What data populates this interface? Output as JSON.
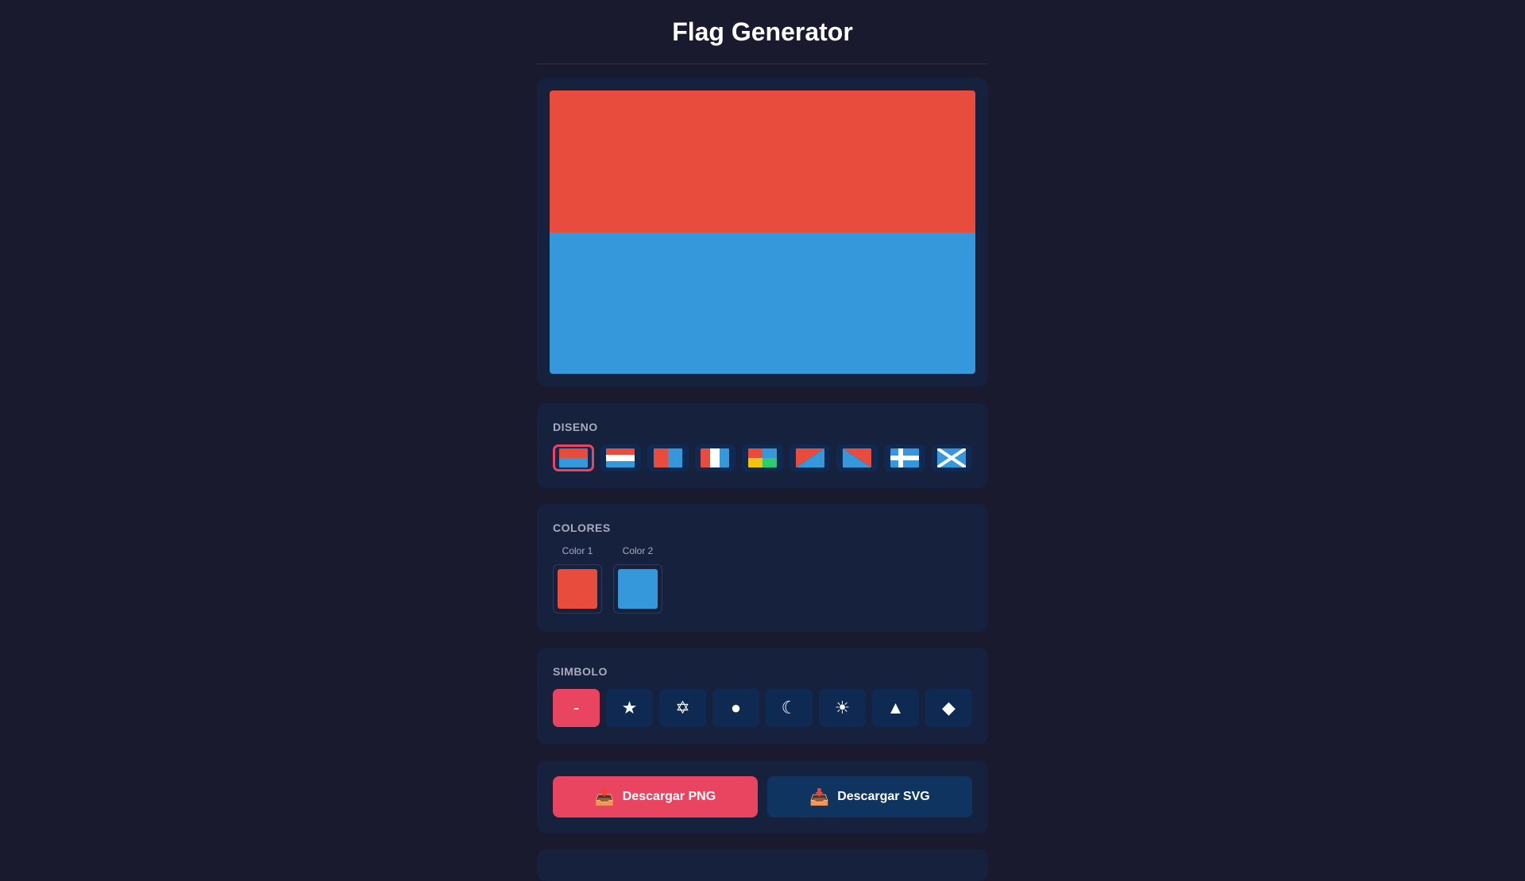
{
  "title": "Flag Generator",
  "preview": {
    "stripe_colors": [
      "#e74c3c",
      "#3498db"
    ]
  },
  "design": {
    "label": "DISENO",
    "selected_index": 0,
    "options": [
      {
        "icon": "horizontal-bicolor-icon"
      },
      {
        "icon": "horizontal-tricolor-icon"
      },
      {
        "icon": "vertical-bicolor-icon"
      },
      {
        "icon": "vertical-tricolor-icon"
      },
      {
        "icon": "quartered-icon"
      },
      {
        "icon": "diagonal-icon"
      },
      {
        "icon": "diagonal-reverse-icon"
      },
      {
        "icon": "nordic-cross-icon"
      },
      {
        "icon": "saltire-icon"
      }
    ]
  },
  "colors": {
    "label": "COLORES",
    "items": [
      {
        "label": "Color 1",
        "value": "#e74c3c"
      },
      {
        "label": "Color 2",
        "value": "#3498db"
      }
    ]
  },
  "symbol": {
    "label": "SIMBOLO",
    "selected_index": 0,
    "options": [
      {
        "glyph": "-",
        "icon": "none-icon"
      },
      {
        "glyph": "★",
        "icon": "star-icon"
      },
      {
        "glyph": "✡",
        "icon": "star-of-david-icon"
      },
      {
        "glyph": "●",
        "icon": "circle-icon"
      },
      {
        "glyph": "☾",
        "icon": "crescent-moon-icon"
      },
      {
        "glyph": "☀",
        "icon": "sun-icon"
      },
      {
        "glyph": "▲",
        "icon": "triangle-icon"
      },
      {
        "glyph": "◆",
        "icon": "diamond-icon"
      }
    ]
  },
  "download": {
    "png_label": "Descargar PNG",
    "svg_label": "Descargar SVG",
    "icon_glyph": "📥",
    "icon": "inbox-tray-icon"
  },
  "theme": {
    "accent": "#e94560",
    "background": "#1a1a2e",
    "card": "#16213e",
    "button": "#0f3460",
    "white": "#ffffff",
    "green": "#2ecc71",
    "yellow": "#f1c40f"
  }
}
